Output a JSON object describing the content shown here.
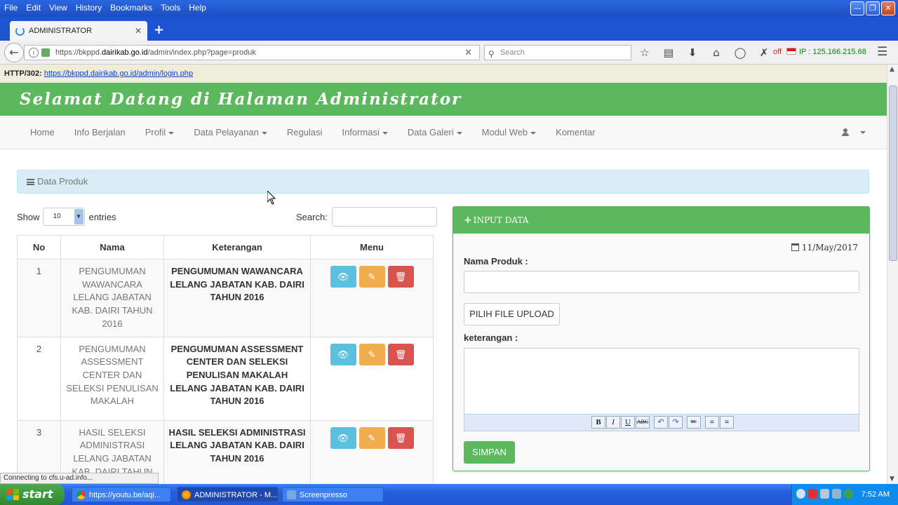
{
  "browser": {
    "menus": [
      "File",
      "Edit",
      "View",
      "History",
      "Bookmarks",
      "Tools",
      "Help"
    ],
    "tab_title": "ADMINISTRATOR",
    "url_prefix": "https://bkppd.",
    "url_domain": "dairikab.go.id",
    "url_suffix": "/admin/index.php?page=produk",
    "search_placeholder": "Search",
    "off_label": "off",
    "ip_label": "IP : 125.166.215.68",
    "http_status": "HTTP/302:",
    "http_link": "https://bkppd.dairikab.go.id/admin/login.php",
    "status_text": "Connecting to cfs.u-ad.info..."
  },
  "site": {
    "banner_title": "Selamat Datang di Halaman Administrator",
    "nav": [
      {
        "label": "Home",
        "dropdown": false
      },
      {
        "label": "Info Berjalan",
        "dropdown": false
      },
      {
        "label": "Profil",
        "dropdown": true
      },
      {
        "label": "Data Pelayanan",
        "dropdown": true
      },
      {
        "label": "Regulasi",
        "dropdown": false
      },
      {
        "label": "Informasi",
        "dropdown": true
      },
      {
        "label": "Data Galeri",
        "dropdown": true
      },
      {
        "label": "Modul Web",
        "dropdown": true
      },
      {
        "label": "Komentar",
        "dropdown": false
      }
    ]
  },
  "panel": {
    "title": "Data Produk"
  },
  "table_controls": {
    "show_label": "Show",
    "entries_value": "10",
    "entries_label": "entries",
    "search_label": "Search:"
  },
  "table": {
    "headers": [
      "No",
      "Nama",
      "Keterangan",
      "Menu"
    ],
    "rows": [
      {
        "no": "1",
        "nama": "PENGUMUMAN WAWANCARA LELANG JABATAN KAB. DAIRI TAHUN 2016",
        "keterangan": "PENGUMUMAN WAWANCARA LELANG JABATAN KAB. DAIRI TAHUN 2016"
      },
      {
        "no": "2",
        "nama": "PENGUMUMAN ASSESSMENT CENTER DAN SELEKSI PENULISAN MAKALAH",
        "keterangan": "PENGUMUMAN ASSESSMENT CENTER DAN SELEKSI PENULISAN MAKALAH LELANG JABATAN KAB. DAIRI TAHUN 2016"
      },
      {
        "no": "3",
        "nama": "HASIL SELEKSI ADMINISTRASI LELANG JABATAN KAB. DAIRI TAHUN",
        "keterangan": "HASIL SELEKSI ADMINISTRASI LELANG JABATAN KAB. DAIRI TAHUN 2016"
      }
    ]
  },
  "input_panel": {
    "title": "INPUT DATA",
    "date": "11/May/2017",
    "nama_label": "Nama Produk :",
    "upload_label": "PILIH FILE UPLOAD",
    "keterangan_label": "keterangan :",
    "save_label": "SIMPAN"
  },
  "taskbar": {
    "start_label": "start",
    "items": [
      {
        "label": "https://youtu.be/aqi..."
      },
      {
        "label": "ADMINISTRATOR - M..."
      },
      {
        "label": "Screenpresso"
      }
    ],
    "clock": "7:52 AM"
  }
}
